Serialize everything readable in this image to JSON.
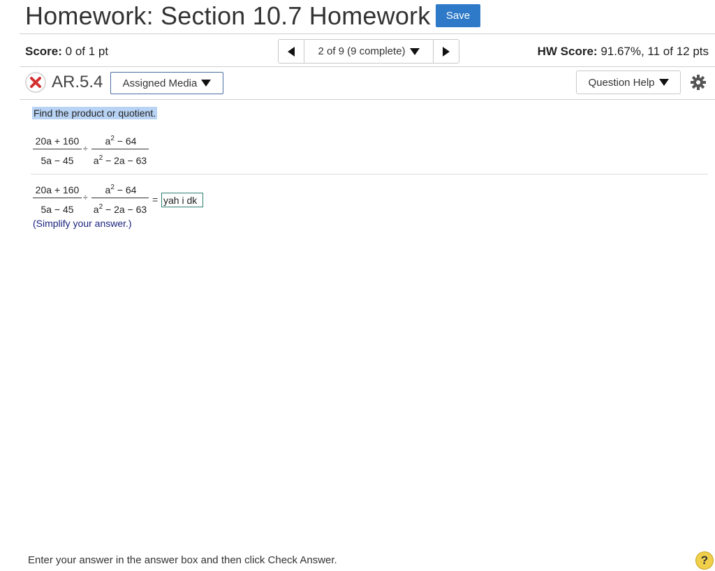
{
  "header": {
    "title": "Homework: Section 10.7 Homework",
    "save_label": "Save"
  },
  "status_bar": {
    "score_label": "Score:",
    "score_value": "0 of 1 pt",
    "nav_position": "2 of 9 (9 complete)",
    "hw_score_label": "HW Score:",
    "hw_score_value": "91.67%, 11 of 12 pts"
  },
  "question_bar": {
    "question_id": "AR.5.4",
    "assigned_media_label": "Assigned Media",
    "question_help_label": "Question Help"
  },
  "question": {
    "instruction": "Find the product or quotient.",
    "problem": {
      "left_num": "20a + 160",
      "left_den": "5a − 45",
      "operator": "÷",
      "right_num_base": "a",
      "right_num_exp": "2",
      "right_num_rest": " − 64",
      "right_den_base": "a",
      "right_den_exp": "2",
      "right_den_rest": " − 2a − 63"
    },
    "equals": "=",
    "answer_value": "yah  i dk",
    "simplify_note": "(Simplify your answer.)"
  },
  "footer": {
    "instruction": "Enter your answer in the answer box and then click Check Answer.",
    "help_icon_text": "?"
  },
  "colors": {
    "save_button": "#2f7ac8",
    "incorrect_x": "#d32f2f",
    "instruction_highlight": "#b9d3f5",
    "simplify_text": "#1a237e",
    "help_icon": "#f0cf4a"
  }
}
